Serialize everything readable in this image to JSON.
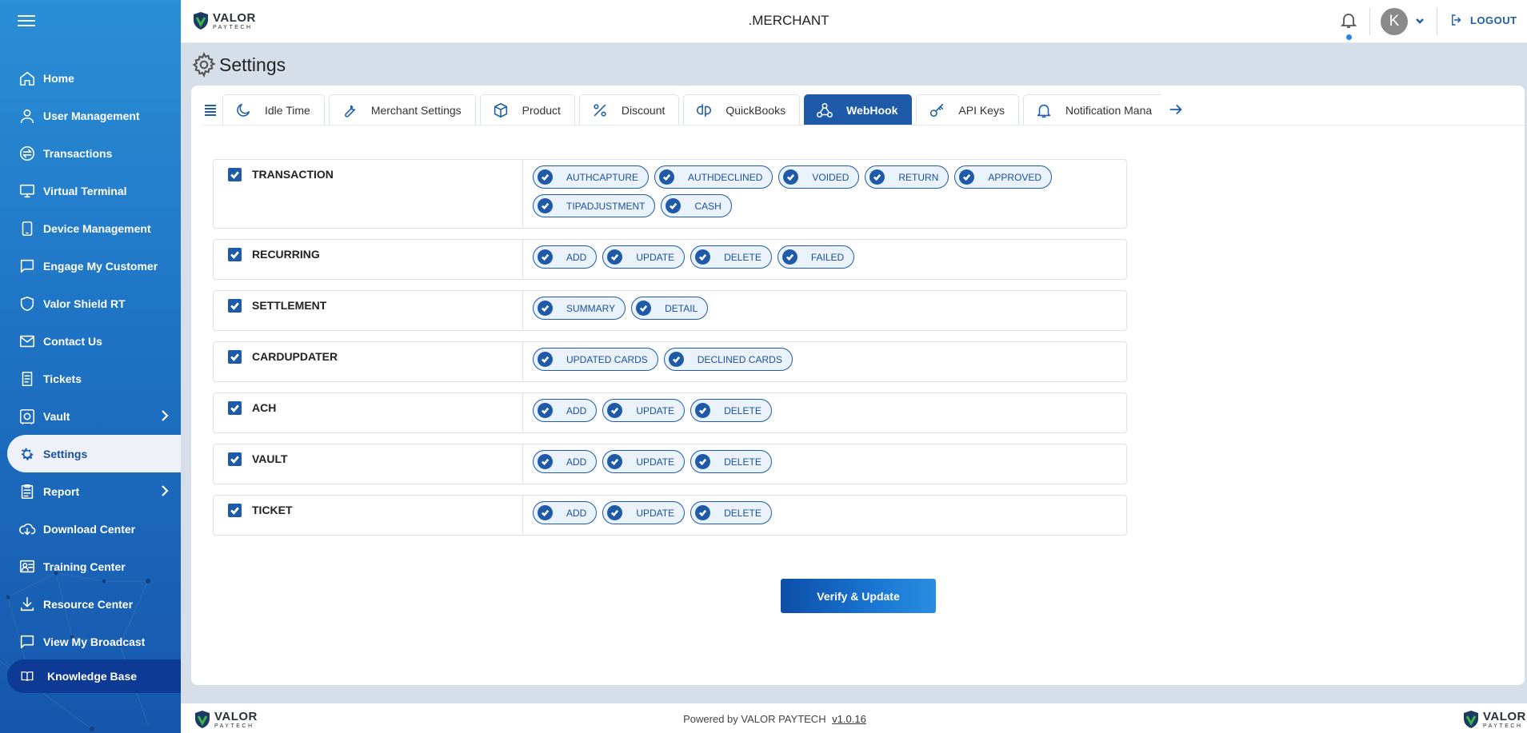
{
  "header": {
    "logo_main": "VALOR",
    "logo_sub": "PAYTECH",
    "title": ".MERCHANT",
    "avatar_initial": "K",
    "logout_label": "LOGOUT"
  },
  "sidebar": {
    "items": [
      {
        "label": "Home",
        "icon": "home-icon"
      },
      {
        "label": "User Management",
        "icon": "user-icon"
      },
      {
        "label": "Transactions",
        "icon": "transfer-icon"
      },
      {
        "label": "Virtual Terminal",
        "icon": "monitor-icon"
      },
      {
        "label": "Device Management",
        "icon": "device-icon"
      },
      {
        "label": "Engage My Customer",
        "icon": "chat-icon"
      },
      {
        "label": "Valor Shield RT",
        "icon": "shield-icon"
      },
      {
        "label": "Contact Us",
        "icon": "mail-icon"
      },
      {
        "label": "Tickets",
        "icon": "ticket-icon"
      },
      {
        "label": "Vault",
        "icon": "vault-icon"
      },
      {
        "label": "Settings",
        "icon": "gear-icon"
      },
      {
        "label": "Report",
        "icon": "clipboard-icon"
      },
      {
        "label": "Download Center",
        "icon": "cloud-download-icon"
      },
      {
        "label": "Training Center",
        "icon": "training-icon"
      },
      {
        "label": "Resource Center",
        "icon": "download-icon"
      },
      {
        "label": "View My Broadcast",
        "icon": "broadcast-icon"
      }
    ],
    "knowledge_base": "Knowledge Base"
  },
  "page": {
    "title": "Settings"
  },
  "tabs": [
    {
      "label": "Idle Time",
      "icon": "moon-icon"
    },
    {
      "label": "Merchant Settings",
      "icon": "wrench-icon"
    },
    {
      "label": "Product",
      "icon": "box-icon"
    },
    {
      "label": "Discount",
      "icon": "percent-icon"
    },
    {
      "label": "QuickBooks",
      "icon": "quickbooks-icon"
    },
    {
      "label": "WebHook",
      "icon": "webhook-icon"
    },
    {
      "label": "API Keys",
      "icon": "key-icon"
    },
    {
      "label": "Notification Mana",
      "icon": "bell-icon"
    }
  ],
  "webhooks": [
    {
      "label": "TRANSACTION",
      "events": [
        "AUTHCAPTURE",
        "AUTHDECLINED",
        "VOIDED",
        "RETURN",
        "APPROVED",
        "TIPADJUSTMENT",
        "CASH"
      ]
    },
    {
      "label": "RECURRING",
      "events": [
        "ADD",
        "UPDATE",
        "DELETE",
        "FAILED"
      ]
    },
    {
      "label": "SETTLEMENT",
      "events": [
        "SUMMARY",
        "DETAIL"
      ]
    },
    {
      "label": "CARDUPDATER",
      "events": [
        "UPDATED CARDS",
        "DECLINED CARDS"
      ]
    },
    {
      "label": "ACH",
      "events": [
        "ADD",
        "UPDATE",
        "DELETE"
      ]
    },
    {
      "label": "VAULT",
      "events": [
        "ADD",
        "UPDATE",
        "DELETE"
      ]
    },
    {
      "label": "TICKET",
      "events": [
        "ADD",
        "UPDATE",
        "DELETE"
      ]
    }
  ],
  "actions": {
    "verify_label": "Verify & Update"
  },
  "footer": {
    "text": "Powered by VALOR PAYTECH",
    "version": "v1.0.16"
  },
  "colors": {
    "primary": "#1e5aa8",
    "sidebar_top": "#2a8fd6",
    "sidebar_bottom": "#1557ad",
    "knowledge_base": "#0d3a95"
  }
}
